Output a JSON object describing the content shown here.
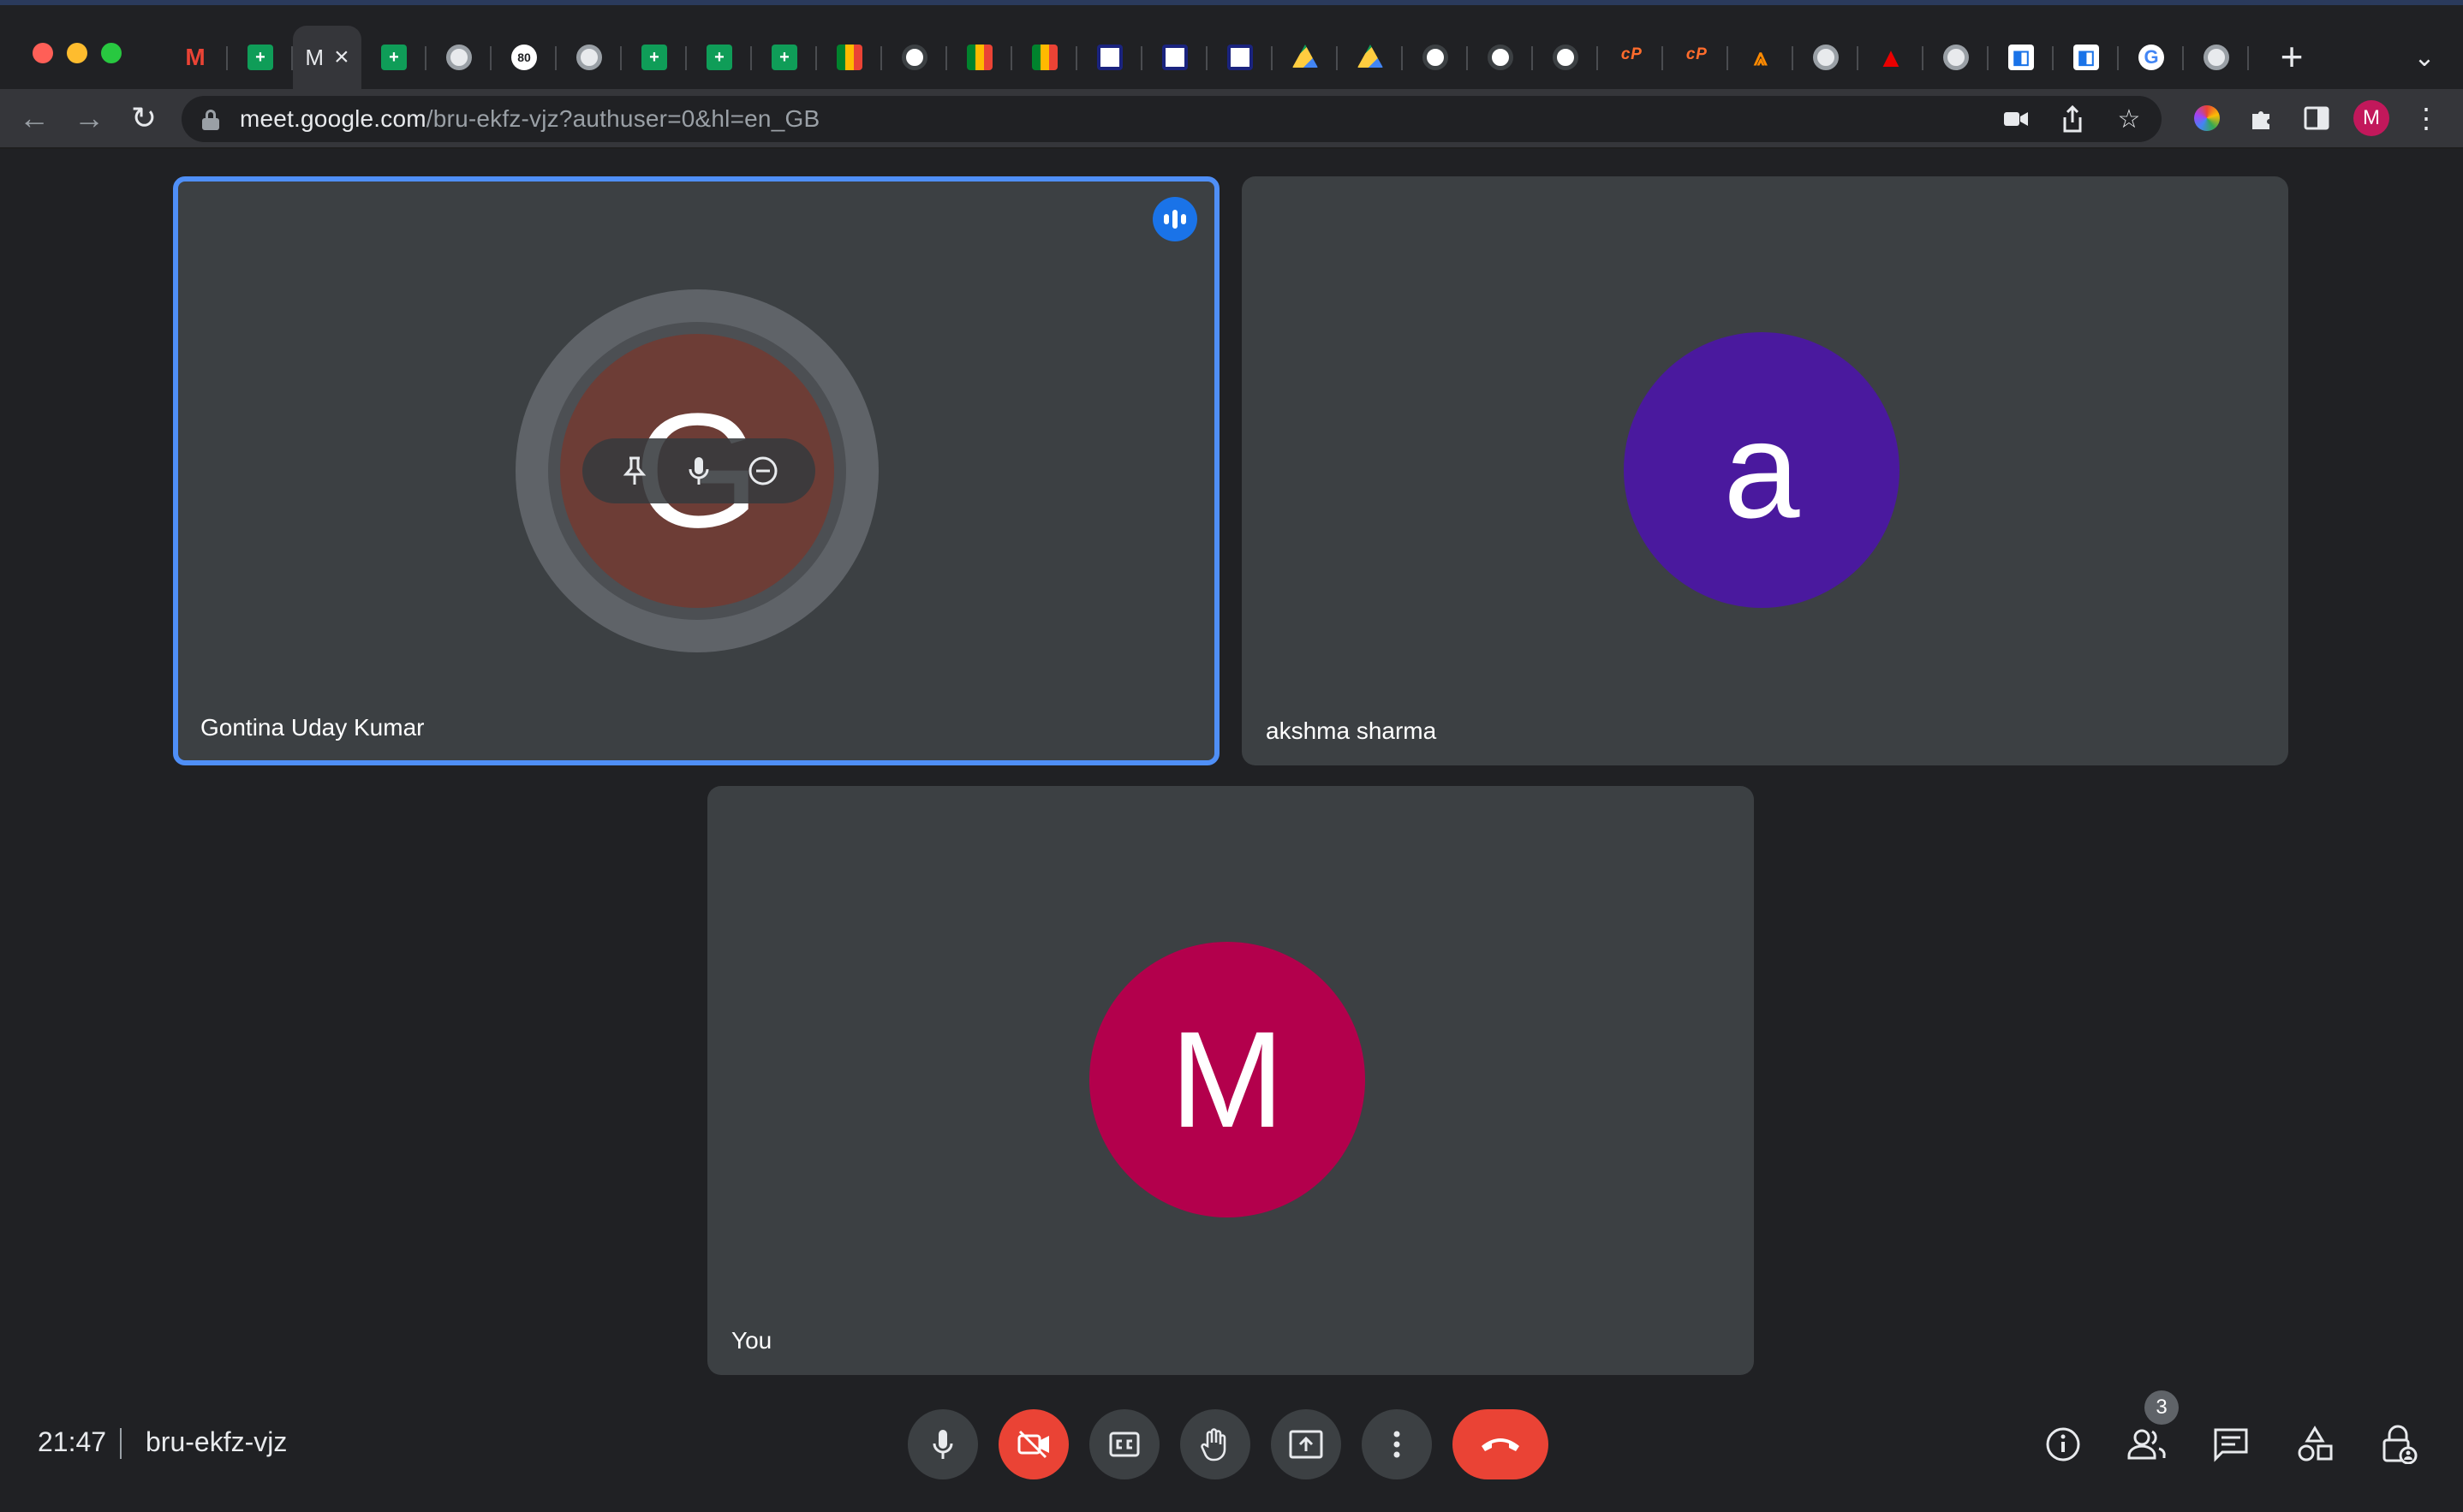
{
  "browser": {
    "active_tab_label": "M",
    "tab_favicons": [
      "gmail-icon",
      "sheets-icon",
      "meet-tab",
      "sheets-icon",
      "globe-icon",
      "whatsapp-icon",
      "globe-icon",
      "sheets-icon",
      "sheets-icon",
      "sheets-icon",
      "meet-icon",
      "globe-icon",
      "meet-icon",
      "meet-icon",
      "vi-icon",
      "vi-icon",
      "vi-icon",
      "drive-icon",
      "drive-icon",
      "globe-icon",
      "globe-icon",
      "globe-icon",
      "cp-icon",
      "cp-icon",
      "bridge-icon",
      "globe-icon",
      "acrobat-icon",
      "globe-icon",
      "book-icon",
      "book-icon",
      "google-icon",
      "globe-icon"
    ],
    "whatsapp_badge": "80",
    "url_host": "meet.google.com",
    "url_path": "/bru-ekfz-vjz?authuser=0&hl=en_GB",
    "profile_initial": "M"
  },
  "meeting": {
    "participants": [
      {
        "name": "Gontina Uday Kumar",
        "initial": "G",
        "color": "#6d3d36",
        "speaking": true
      },
      {
        "name": "akshma sharma",
        "initial": "a",
        "color": "#4a199e"
      },
      {
        "name": "You",
        "initial": "M",
        "color": "#b3004c"
      }
    ],
    "time": "21:47",
    "code": "bru-ekfz-vjz",
    "participant_count": "3"
  },
  "colors": {
    "accent": "#4f8ff7",
    "end_call": "#ea4335",
    "tile_bg": "#3c4043",
    "page_bg": "#202124"
  }
}
